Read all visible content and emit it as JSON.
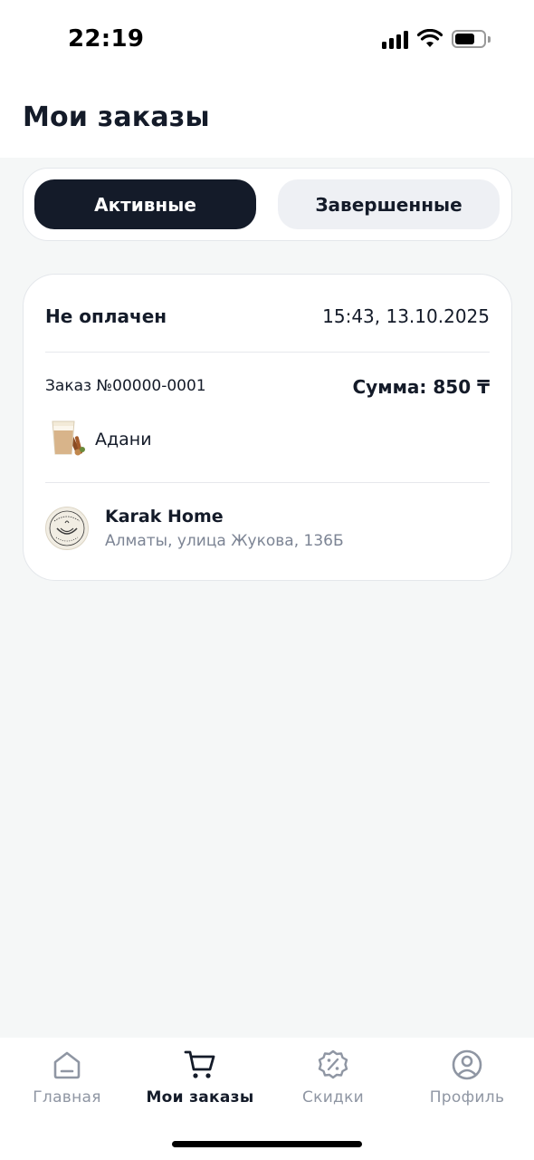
{
  "status_bar": {
    "time": "22:19",
    "icons": [
      "cellular-signal-icon",
      "wifi-icon",
      "battery-icon"
    ]
  },
  "header": {
    "title": "Мои заказы"
  },
  "tabs": {
    "active_label": "Активные",
    "completed_label": "Завершенные",
    "selected": "Активные"
  },
  "order": {
    "status": "Не оплачен",
    "datetime": "15:43, 13.10.2025",
    "number": "Заказ №00000-0001",
    "sum": "Сумма: 850 ₸",
    "items": [
      {
        "name": "Адани",
        "icon": "karak-tea-cup-image"
      }
    ],
    "shop": {
      "name": "Karak Home",
      "address": "Алматы, улица Жукова, 136Б",
      "logo": "karak-home-logo"
    }
  },
  "bottom_nav": {
    "items": [
      {
        "label": "Главная",
        "icon": "home-icon"
      },
      {
        "label": "Мои заказы",
        "icon": "cart-icon"
      },
      {
        "label": "Скидки",
        "icon": "discount-icon"
      },
      {
        "label": "Профиль",
        "icon": "profile-icon"
      }
    ],
    "active": "Мои заказы"
  },
  "colors": {
    "primary_dark": "#141b29",
    "muted_text": "#8f96a3",
    "background": "#f5f7f7",
    "card": "#ffffff"
  }
}
